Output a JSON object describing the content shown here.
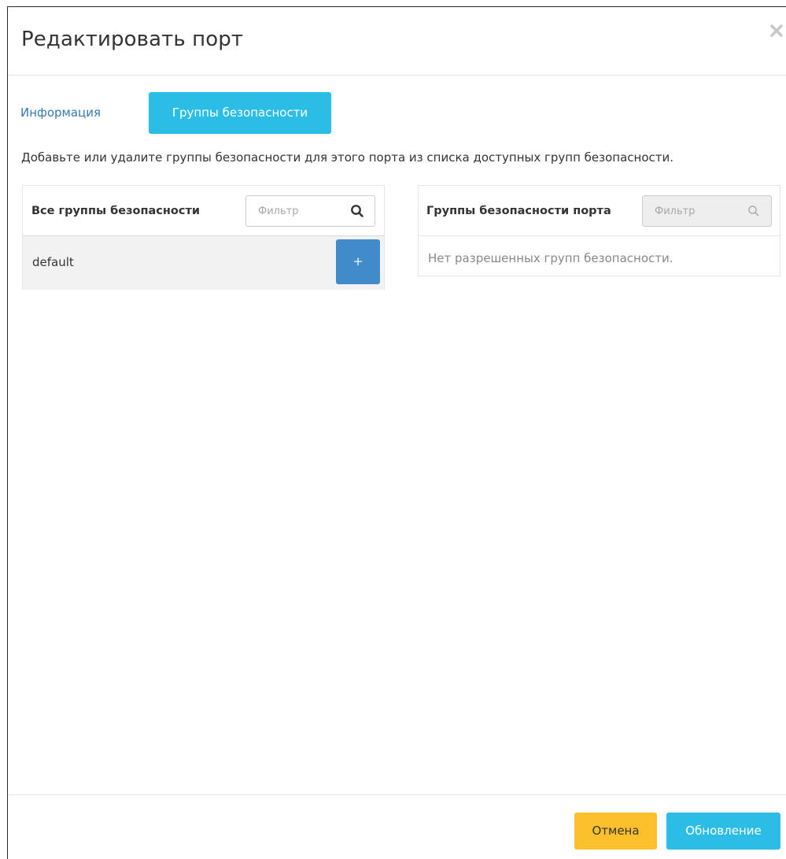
{
  "modal": {
    "title": "Редактировать порт",
    "close_icon": "close-icon"
  },
  "tabs": [
    {
      "label": "Информация",
      "active": false
    },
    {
      "label": "Группы безопасности",
      "active": true
    }
  ],
  "help_text": "Добавьте или удалите группы безопасности для этого порта из списка доступных групп безопасности.",
  "available": {
    "title": "Все группы безопасности",
    "filter_placeholder": "Фильтр",
    "filter_icon": "search-icon",
    "items": [
      {
        "name": "default",
        "action_label": "+"
      }
    ]
  },
  "allocated": {
    "title": "Группы безопасности порта",
    "filter_placeholder": "Фильтр",
    "filter_icon": "search-icon",
    "empty_text": "Нет разрешенных групп безопасности."
  },
  "footer": {
    "cancel_label": "Отмена",
    "submit_label": "Обновление"
  },
  "colors": {
    "primary_tab": "#2bbde6",
    "add_button": "#428bca",
    "cancel_button": "#fcc02c",
    "submit_button": "#2bbde6",
    "link": "#337ab7"
  }
}
